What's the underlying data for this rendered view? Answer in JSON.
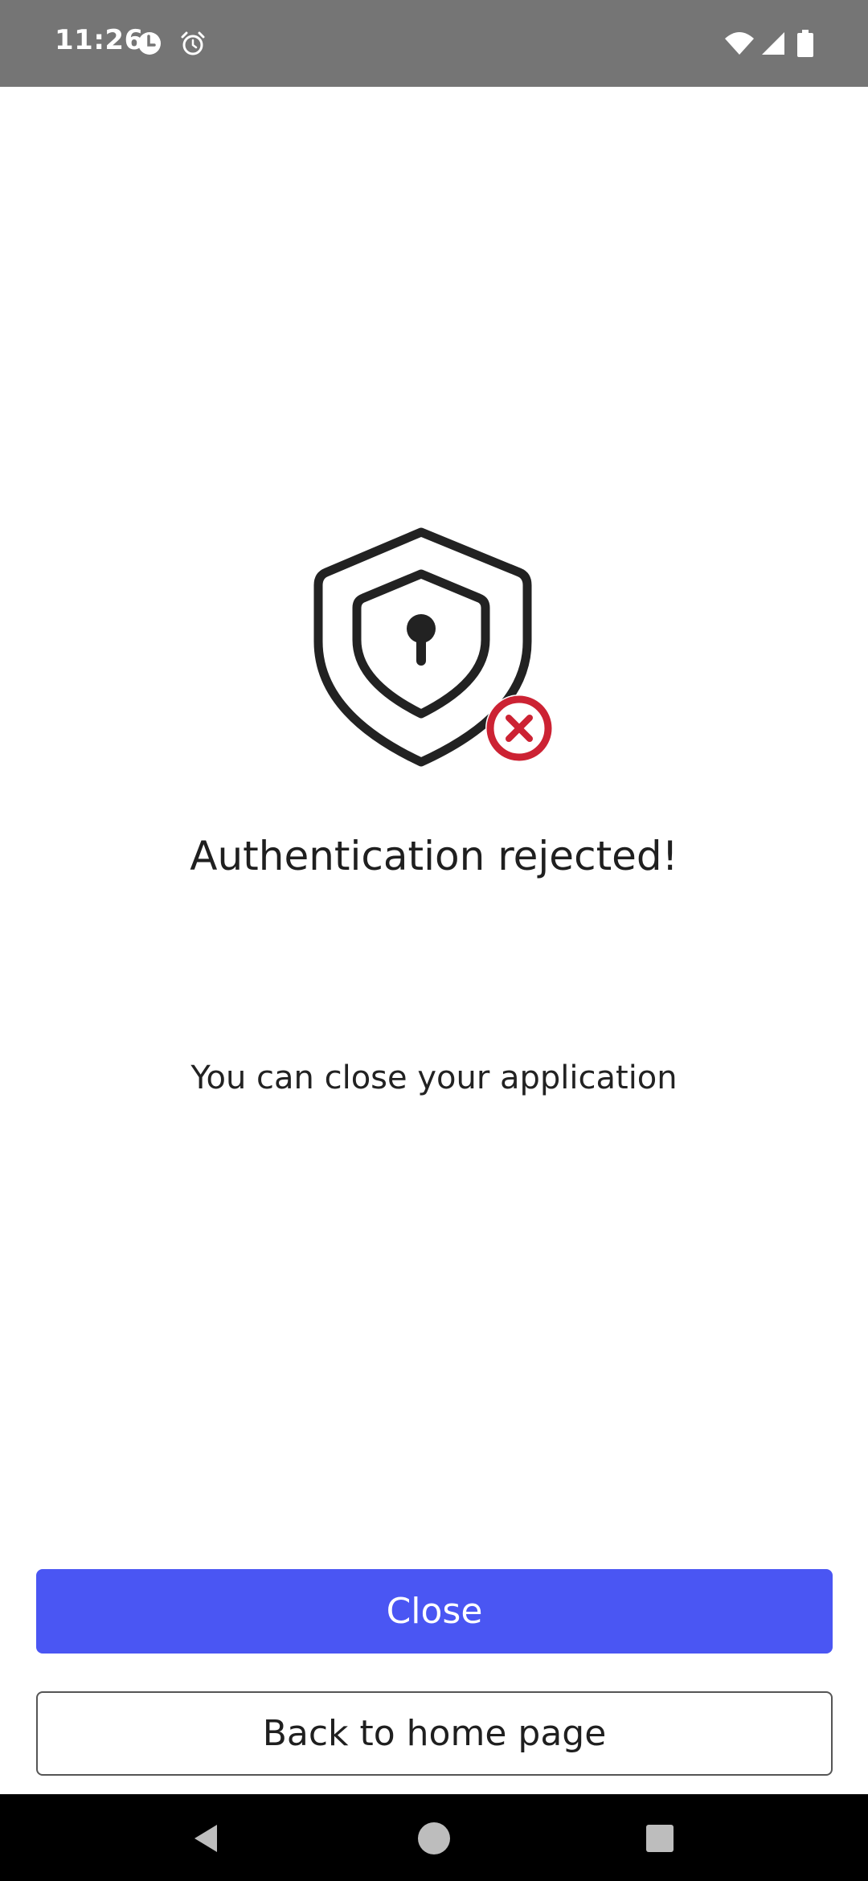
{
  "status_bar": {
    "time": "11:26",
    "icons": [
      "data-saver-icon",
      "alarm-icon",
      "wifi-icon",
      "signal-icon",
      "battery-icon"
    ]
  },
  "main": {
    "icon": "shield-lock-rejected-icon",
    "title": "Authentication rejected!",
    "subtitle": "You can close your application"
  },
  "actions": {
    "close_label": "Close",
    "home_label": "Back to home page"
  },
  "nav_bar": {
    "icons": [
      "back-icon",
      "home-icon",
      "recents-icon"
    ]
  },
  "colors": {
    "status_bar": "#757575",
    "primary": "#4a56f3",
    "error": "#cc2233",
    "icon_stroke": "#222222",
    "nav_bar": "#000000"
  }
}
